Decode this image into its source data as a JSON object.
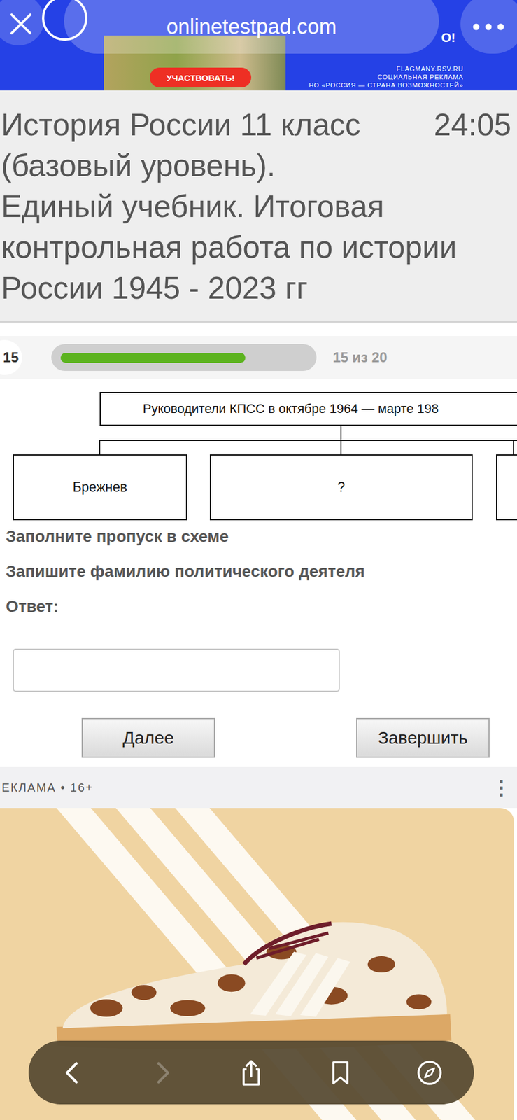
{
  "browser": {
    "url": "onlinetestpad.com"
  },
  "banner": {
    "button": "УЧАСТВОВАТЬ!",
    "site": "FLAGMANY.RSV.RU",
    "label": "СОЦИАЛЬНАЯ РЕКЛАМА",
    "sponsor": "НО «РОССИЯ — СТРАНА ВОЗМОЖНОСТЕЙ»",
    "tail": "О!"
  },
  "test": {
    "title": [
      "История России 11 класс (базовый уровень).",
      "Единый учебник. Итоговая контрольная работа по истории России 1945 - 2023 гг"
    ],
    "timer": "24:05"
  },
  "progress": {
    "current": "15",
    "text": "15 из 20",
    "level": 0.75
  },
  "question": {
    "diagram": {
      "header": "Руководители КПСС в октябре 1964 — марте 198",
      "nodes": [
        {
          "label": "Брежнев"
        },
        {
          "label": "?"
        },
        {
          "label": ""
        }
      ]
    },
    "instructions": [
      "Заполните пропуск в схеме",
      "Запишите фамилию политического деятеля"
    ],
    "answer_label": "Ответ:",
    "answer_value": ""
  },
  "buttons": [
    "Далее",
    "Завершить"
  ],
  "ad": {
    "label": "ЕКЛАМА • 16+",
    "menu": "⋮"
  },
  "toolbar": [
    {
      "kind": "back",
      "disabled": false
    },
    {
      "kind": "forward",
      "disabled": true
    },
    {
      "kind": "share",
      "disabled": false
    },
    {
      "kind": "bookmarks",
      "disabled": false
    },
    {
      "kind": "compass",
      "disabled": false
    }
  ]
}
